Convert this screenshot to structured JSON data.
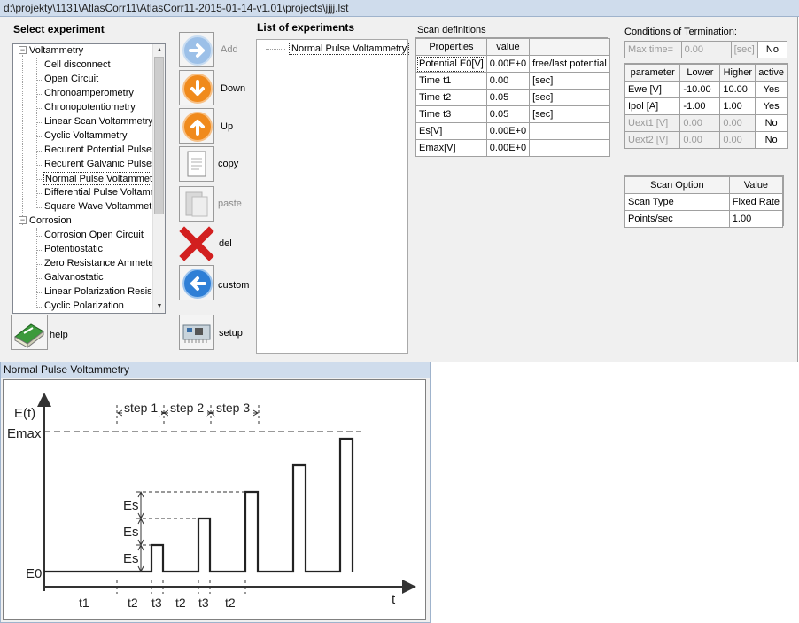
{
  "window": {
    "title": "d:\\projekty\\1131\\AtlasCorr11\\AtlasCorr11-2015-01-14-v1.01\\projects\\jjjj.lst"
  },
  "select_experiment": {
    "label": "Select experiment",
    "groups": [
      {
        "label": "Voltammetry",
        "toggle": "−"
      },
      {
        "label": "Corrosion",
        "toggle": "−"
      }
    ],
    "voltammetry_items": [
      "Cell disconnect",
      "Open Circuit",
      "Chronoamperometry",
      "Chronopotentiometry",
      "Linear Scan Voltammetry",
      "Cyclic Voltammetry",
      "Recurent Potential Pulses",
      "Recurent Galvanic Pulses",
      "Normal Pulse Voltammetry",
      "Differential Pulse Voltammetry",
      "Square Wave Voltammetry"
    ],
    "corrosion_items": [
      "Corrosion Open Circuit",
      "Potentiostatic",
      "Zero Resistance Ammeter",
      "Galvanostatic",
      "Linear Polarization Resistance",
      "Cyclic Polarization"
    ]
  },
  "toolbar": {
    "add": "Add",
    "down": "Down",
    "up": "Up",
    "copy": "copy",
    "paste": "paste",
    "del": "del",
    "custom": "custom",
    "setup": "setup",
    "help": "help"
  },
  "experiments": {
    "label": "List of experiments",
    "items": [
      "Normal Pulse Voltammetry"
    ]
  },
  "scan_definitions": {
    "label": "Scan definitions",
    "headers": [
      "Properties",
      "value",
      ""
    ],
    "rows": [
      [
        "Potential E0[V]",
        "0.00E+0",
        "free/last potential"
      ],
      [
        "Time t1",
        "0.00",
        "[sec]"
      ],
      [
        "Time t2",
        "0.05",
        "[sec]"
      ],
      [
        "Time t3",
        "0.05",
        "[sec]"
      ],
      [
        "Es[V]",
        "0.00E+0",
        ""
      ],
      [
        "Emax[V]",
        "0.00E+0",
        ""
      ]
    ]
  },
  "termination": {
    "label": "Conditions of Termination:",
    "max_time": {
      "label": "Max time=",
      "value": "0.00",
      "unit": "[sec]",
      "active": "No"
    },
    "headers": [
      "parameter",
      "Lower",
      "Higher",
      "active"
    ],
    "rows": [
      {
        "cells": [
          "Ewe [V]",
          "-10.00",
          "10.00",
          "Yes"
        ],
        "disabled": false
      },
      {
        "cells": [
          "Ipol [A]",
          "-1.00",
          "1.00",
          "Yes"
        ],
        "disabled": false
      },
      {
        "cells": [
          "Uext1 [V]",
          "0.00",
          "0.00",
          "No"
        ],
        "disabled": true
      },
      {
        "cells": [
          "Uext2 [V]",
          "0.00",
          "0.00",
          "No"
        ],
        "disabled": true
      }
    ]
  },
  "scan_option": {
    "headers": [
      "Scan Option",
      "Value"
    ],
    "rows": [
      [
        "Scan Type",
        "Fixed Rate"
      ],
      [
        "Points/sec",
        "1.00"
      ]
    ]
  },
  "diagram": {
    "window_title": "Normal Pulse Voltammetry",
    "y_axis_label": "E(t)",
    "x_axis_label": "t",
    "emax_label": "Emax",
    "e0_label": "E0",
    "es_label": "Es",
    "step_labels": [
      "step 1",
      "step 2",
      "step 3"
    ],
    "time_labels": [
      "t1",
      "t2",
      "t3",
      "t2",
      "t3",
      "t2"
    ]
  },
  "colors": {
    "titlebar": "#cfdcec",
    "panel": "#f0f0f0",
    "arrow_blue": "#2f7fd6",
    "arrow_orange": "#f08a1c",
    "del_red": "#d21f1f",
    "help_green": "#3c9a3c"
  }
}
